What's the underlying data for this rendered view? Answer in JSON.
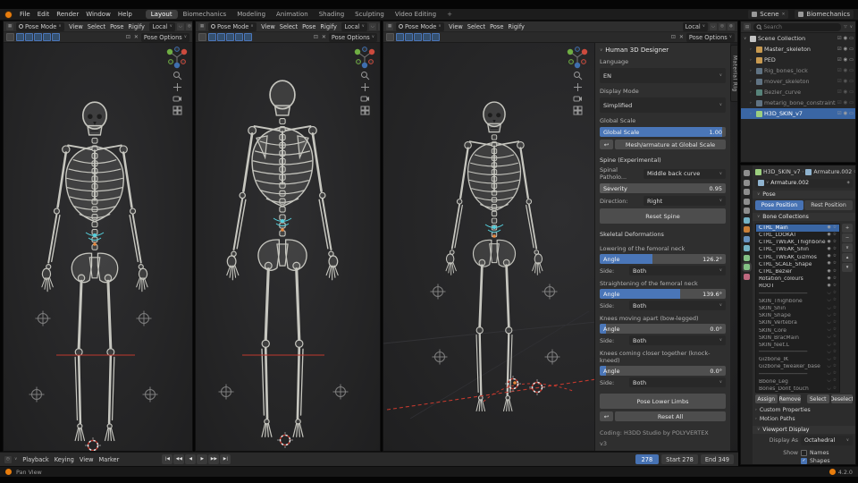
{
  "colors": {
    "accent_blue": "#4772b3",
    "selection_blue": "#3a66a4",
    "overlay_red": "#c0392e",
    "bone_highlight_cyan": "#55d0dd",
    "empty_orange": "#e8873c"
  },
  "icons": {
    "dropdown": "∨",
    "collapsed": "›",
    "expanded": "∨",
    "undo": "↩",
    "close": "✕",
    "lock": "⊡",
    "checkbox": "☑",
    "eye_open": "◉",
    "eye_closed": "◡",
    "screen": "▭",
    "star": "☆",
    "funnel": "▽",
    "pin": "⊙",
    "shield": "◈",
    "clock": "◷"
  },
  "topbar": {
    "menus": [
      "File",
      "Edit",
      "Render",
      "Window",
      "Help"
    ],
    "workspaces": [
      {
        "label": "Layout",
        "cls": "active"
      },
      {
        "label": "Biomechanics",
        "cls": ""
      },
      {
        "label": "Modeling",
        "cls": ""
      },
      {
        "label": "Animation",
        "cls": ""
      },
      {
        "label": "Shading",
        "cls": ""
      },
      {
        "label": "Sculpting",
        "cls": ""
      },
      {
        "label": "Video Editing",
        "cls": ""
      },
      {
        "label": "+",
        "cls": "plus"
      }
    ],
    "scene_label": "Scene",
    "view_layer_label": "Biomechanics"
  },
  "viewport": {
    "mode": "Pose Mode",
    "menus": [
      "View",
      "Select",
      "Pose",
      "Rigify"
    ],
    "orientation": "Local",
    "options_label": "Pose Options"
  },
  "sidebar_tab": "Material Rig",
  "panel": {
    "title": "Human 3D Designer",
    "language_label": "Language",
    "language": "EN",
    "display_mode_label": "Display Mode",
    "display_mode": "Simplified",
    "global_scale_label": "Global Scale",
    "global_scale_name": "Global Scale",
    "global_scale_value": "1.00",
    "apply_scale_button": "Mesh/armature at Global Scale",
    "spine_section": "Spine (Experimental)",
    "pathology_label": "Spinal Patholo...",
    "pathology": "Middle back curve",
    "severity_name": "Severity",
    "severity_value": "0.95",
    "direction_label": "Direction:",
    "direction": "Right",
    "reset_spine_button": "Reset Spine",
    "deform_section": "Skeletal Deformations",
    "deform_rows": [
      {
        "label": "Lowering of the femoral neck",
        "name": "Angle",
        "value": "126.2°",
        "fill": 42,
        "side_label": "Side:",
        "side": "Both"
      },
      {
        "label": "Straightening of the femoral neck",
        "name": "Angle",
        "value": "139.6°",
        "fill": 64,
        "side_label": "Side:",
        "side": "Both"
      },
      {
        "label": "Knees moving apart (bow-legged)",
        "name": "Angle",
        "value": "0.0°",
        "fill": 5,
        "side_label": "Side:",
        "side": "Both"
      },
      {
        "label": "Knees coming closer together (knock-kneed)",
        "name": "Angle",
        "value": "0.0°",
        "fill": 5,
        "side_label": "Side:",
        "side": "Both"
      }
    ],
    "pose_lower_limbs_button": "Pose Lower Limbs",
    "reset_all_button": "Reset All",
    "credits": "Coding: H3DD Studio by POLYVERTEX",
    "version": "v3"
  },
  "outliner": {
    "search_placeholder": "Search",
    "items": [
      {
        "label": "Scene Collection",
        "icon": "ic-col-white",
        "iconname": "collection-icon",
        "cls": "root",
        "caret": "∨"
      },
      {
        "label": "Master_skeleton",
        "icon": "ic-col",
        "iconname": "collection-icon",
        "cls": "",
        "caret": "›"
      },
      {
        "label": "PED",
        "icon": "ic-col",
        "iconname": "collection-icon",
        "cls": "",
        "caret": "›"
      },
      {
        "label": "Rig_bones_lock",
        "icon": "ic-arm",
        "iconname": "armature-icon",
        "cls": "muted",
        "caret": "›"
      },
      {
        "label": "mover_skeleton",
        "icon": "ic-arm",
        "iconname": "armature-icon",
        "cls": "muted",
        "caret": "›"
      },
      {
        "label": "Bezier_curve",
        "icon": "ic-crv",
        "iconname": "curve-icon",
        "cls": "muted",
        "caret": "›"
      },
      {
        "label": "metarig_bone_constraints",
        "icon": "ic-arm",
        "iconname": "armature-icon",
        "cls": "muted",
        "caret": "›"
      },
      {
        "label": "H3D_SKIN_v7",
        "icon": "ic-msh",
        "iconname": "mesh-icon",
        "cls": "selected",
        "caret": "›"
      }
    ]
  },
  "properties": {
    "breadcrumb_object": "H3D_SKIN_v7",
    "breadcrumb_data": "Armature.002",
    "datablock_name": "Armature.002",
    "pose_panel_label": "Pose",
    "pose_position": "Pose Position",
    "rest_position": "Rest Position",
    "bone_collections_label": "Bone Collections",
    "bc_tools": [
      "+",
      "−",
      "∨",
      "▴",
      "▾"
    ],
    "bone_collections": [
      {
        "name": "CTRL_Main",
        "cls": "selected",
        "eye": "◉"
      },
      {
        "name": "CTRL_LOOKAT",
        "cls": "",
        "eye": "◉"
      },
      {
        "name": "CTRL_TWEAK_Thighbone",
        "cls": "",
        "eye": "◉"
      },
      {
        "name": "CTRL_TWEAK_Shin",
        "cls": "",
        "eye": "◉"
      },
      {
        "name": "CTRL_TWEAK_Gizmos",
        "cls": "",
        "eye": "◉"
      },
      {
        "name": "CTRL_SCALE_Shape",
        "cls": "",
        "eye": "◉"
      },
      {
        "name": "CTRL_Bezier",
        "cls": "",
        "eye": "◉"
      },
      {
        "name": "Rotation_colours",
        "cls": "",
        "eye": "◉"
      },
      {
        "name": "ROOT",
        "cls": "",
        "eye": "◉"
      },
      {
        "name": "───────────────",
        "cls": "div off",
        "eye": "◡"
      },
      {
        "name": "SKIN_Thighbone",
        "cls": "off",
        "eye": "◡"
      },
      {
        "name": "SKIN_Shin",
        "cls": "off",
        "eye": "◡"
      },
      {
        "name": "SKIN_Shape",
        "cls": "off",
        "eye": "◡"
      },
      {
        "name": "SKIN_Vertebra",
        "cls": "off",
        "eye": "◡"
      },
      {
        "name": "SKIN_Core",
        "cls": "off",
        "eye": "◡"
      },
      {
        "name": "SKIN_BracMain",
        "cls": "off",
        "eye": "◡"
      },
      {
        "name": "SKIN_feet.L",
        "cls": "off",
        "eye": "◡"
      },
      {
        "name": "───────────────",
        "cls": "div off",
        "eye": "◡"
      },
      {
        "name": "Gizbone_IK",
        "cls": "off",
        "eye": "◡"
      },
      {
        "name": "Gizbone_tweaker_base",
        "cls": "off",
        "eye": "◡"
      },
      {
        "name": "───────────────",
        "cls": "div off",
        "eye": "◡"
      },
      {
        "name": "Bbone_Leg",
        "cls": "off",
        "eye": "◡"
      },
      {
        "name": "Bones_Dont_touch",
        "cls": "off",
        "eye": "◡"
      }
    ],
    "assign": "Assign",
    "remove": "Remove",
    "select": "Select",
    "deselect": "Deselect",
    "custom_properties": "Custom Properties",
    "motion_paths": "Motion Paths",
    "viewport_display": "Viewport Display",
    "display_as_label": "Display As",
    "display_as": "Octahedral",
    "show_options": [
      {
        "rowlabel": "Show",
        "label": "Names",
        "checked": false
      },
      {
        "rowlabel": "",
        "label": "Shapes",
        "checked": true
      }
    ],
    "tabs": [
      {
        "name": "tool-icon",
        "cls": "pt-gray"
      },
      {
        "name": "render-icon",
        "cls": "pt-gray"
      },
      {
        "name": "output-icon",
        "cls": "pt-gray"
      },
      {
        "name": "view-layer-icon",
        "cls": "pt-gray"
      },
      {
        "name": "scene-icon",
        "cls": "pt-gray"
      },
      {
        "name": "world-icon",
        "cls": "pt-teal"
      },
      {
        "name": "object-icon",
        "cls": "pt-orange"
      },
      {
        "name": "modifiers-icon",
        "cls": "pt-blue"
      },
      {
        "name": "physics-icon",
        "cls": "pt-teal"
      },
      {
        "name": "constraints-icon",
        "cls": "pt-green"
      },
      {
        "name": "object-data-icon",
        "cls": "pt-green active"
      },
      {
        "name": "material-icon",
        "cls": "pt-red"
      }
    ]
  },
  "timeline": {
    "menus": [
      "Playback",
      "Keying",
      "View",
      "Marker"
    ],
    "transport": [
      "|◀",
      "◀◀",
      "◀",
      "▶",
      "▶▶",
      "▶|"
    ],
    "current_frame": "278",
    "start_label": "Start",
    "start_value": "278",
    "end_label": "End",
    "end_value": "349"
  },
  "statusbar": {
    "hint": "Pan View",
    "version": "4.2.0"
  }
}
